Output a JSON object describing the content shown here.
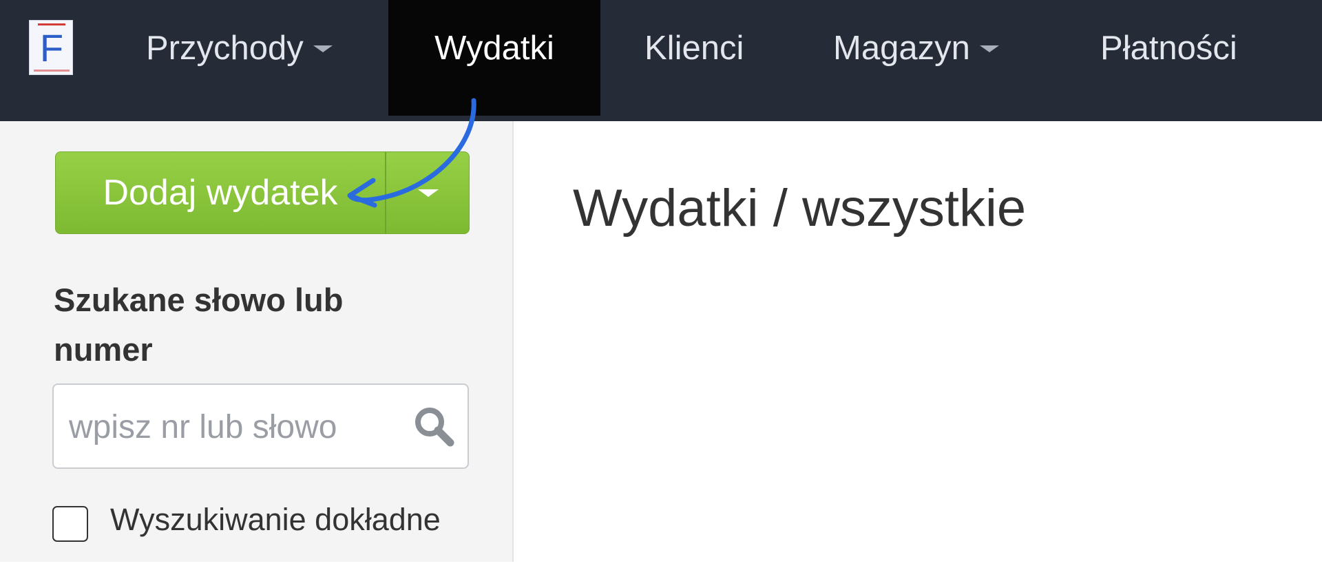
{
  "app": {
    "logo_letter": "F"
  },
  "nav": {
    "items": [
      {
        "label": "Przychody",
        "has_dropdown": true,
        "active": false
      },
      {
        "label": "Wydatki",
        "has_dropdown": false,
        "active": true
      },
      {
        "label": "Klienci",
        "has_dropdown": false,
        "active": false
      },
      {
        "label": "Magazyn",
        "has_dropdown": true,
        "active": false
      },
      {
        "label": "Płatności",
        "has_dropdown": false,
        "active": false
      }
    ]
  },
  "sidebar": {
    "add_button_label": "Dodaj wydatek",
    "search": {
      "label": "Szukane słowo lub numer",
      "placeholder": "wpisz nr lub słowo",
      "value": ""
    },
    "exact_search": {
      "label": "Wyszukiwanie dokładne",
      "checked": false
    }
  },
  "main": {
    "title": "Wydatki / wszystkie"
  },
  "colors": {
    "navbar": "#252c38",
    "nav_active": "#060606",
    "add_button": "#8cc63f",
    "annotation_arrow": "#2a6be0"
  }
}
